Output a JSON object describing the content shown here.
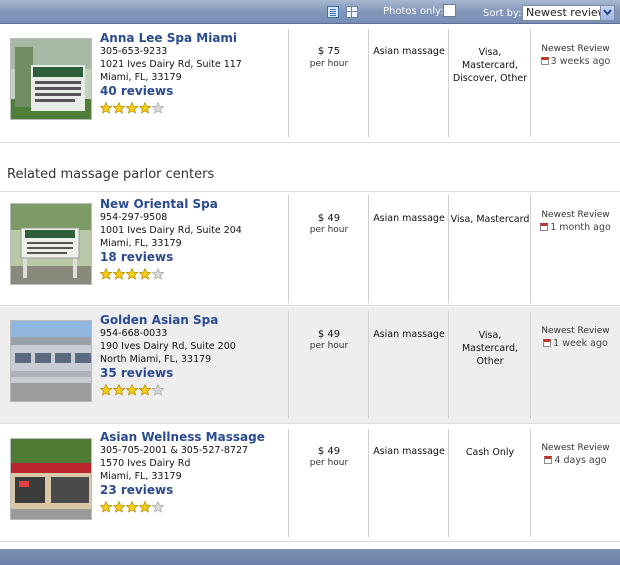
{
  "toolbar": {
    "photos_only_label": "Photos only:",
    "sort_label": "Sort by:",
    "sort_value": "Newest review",
    "view_list_icon": "list-view-icon",
    "view_grid_icon": "grid-view-icon"
  },
  "related_heading": "Related massage parlor centers",
  "listings": [
    {
      "name": "Anna Lee Spa Miami",
      "phone": "305-653-9233",
      "address": "1021 Ives Dairy Rd, Suite 117",
      "city": "Miami, FL, 33179",
      "reviews": "40 reviews",
      "rating": 4,
      "rating_max": 5,
      "price": "$ 75",
      "price_unit": "per hour",
      "service": "Asian massage",
      "payment_line1": "Visa, Mastercard,",
      "payment_line2": "Discover, Other",
      "newest_label": "Newest Review",
      "newest_ago": "3 weeks ago"
    },
    {
      "name": "New Oriental Spa",
      "phone": "954-297-9508",
      "address": "1001 Ives Dairy Rd, Suite 204",
      "city": "Miami, FL, 33179",
      "reviews": "18 reviews",
      "rating": 4,
      "rating_max": 5,
      "price": "$ 49",
      "price_unit": "per hour",
      "service": "Asian massage",
      "payment_line1": "Visa, Mastercard",
      "payment_line2": "",
      "newest_label": "Newest Review",
      "newest_ago": "1 month ago"
    },
    {
      "name": "Golden Asian Spa",
      "phone": "954-668-0033",
      "address": "190 Ives Dairy Rd, Suite 200",
      "city": "North Miami, FL, 33179",
      "reviews": "35 reviews",
      "rating": 4,
      "rating_max": 5,
      "price": "$ 49",
      "price_unit": "per hour",
      "service": "Asian massage",
      "payment_line1": "Visa, Mastercard,",
      "payment_line2": "Other",
      "newest_label": "Newest Review",
      "newest_ago": "1 week ago"
    },
    {
      "name": "Asian Wellness Massage",
      "phone": "305-705-2001 & 305-527-8727",
      "address": "1570 Ives Dairy Rd",
      "city": "Miami, FL, 33179",
      "reviews": "23 reviews",
      "rating": 4,
      "rating_max": 5,
      "price": "$ 49",
      "price_unit": "per hour",
      "service": "Asian massage",
      "payment_line1": "Cash Only",
      "payment_line2": "",
      "newest_label": "Newest Review",
      "newest_ago": "4 days ago"
    }
  ]
}
